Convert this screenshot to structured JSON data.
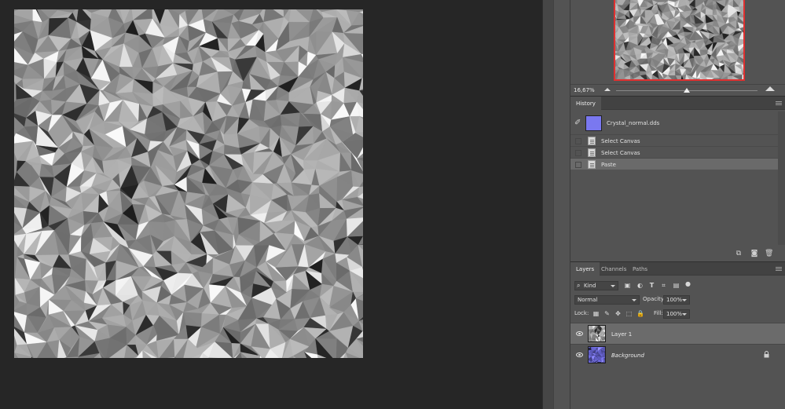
{
  "navigator": {
    "zoom": "16,67%",
    "zoom_slider_value": 0.5
  },
  "history": {
    "tab_label": "History",
    "snapshot_label": "Crystal_normal.dds",
    "steps": [
      {
        "label": "Select Canvas"
      },
      {
        "label": "Select Canvas"
      },
      {
        "label": "Paste"
      }
    ]
  },
  "layers": {
    "tabs": [
      "Layers",
      "Channels",
      "Paths"
    ],
    "filter_kind": "Kind",
    "blend_mode": "Normal",
    "opacity_label": "Opacity:",
    "opacity_value": "100%",
    "lock_label": "Lock:",
    "fill_label": "Fill:",
    "fill_value": "100%",
    "items": [
      {
        "name": "Layer 1"
      },
      {
        "name": "Background"
      }
    ]
  },
  "colors": {
    "app_bg": "#262626",
    "panel_bg": "#535353",
    "navigator_frame": "#e03030",
    "normal_map": "#7a78f0"
  },
  "icons": [
    "history-brush-icon",
    "new-document-from-state-icon",
    "new-snapshot-icon",
    "trash-icon",
    "eye-icon",
    "lock-icon"
  ]
}
